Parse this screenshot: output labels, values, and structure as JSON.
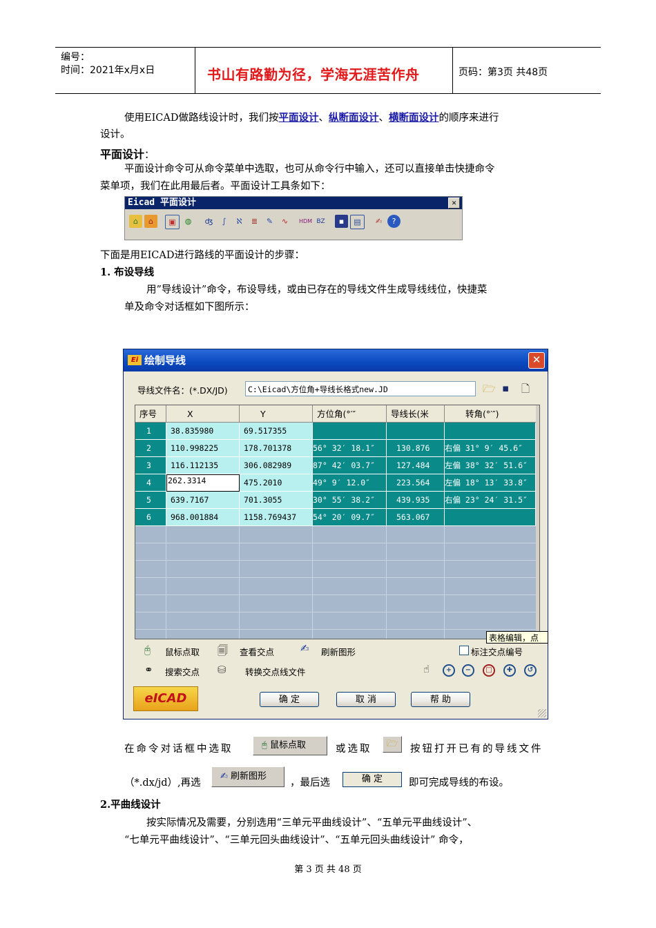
{
  "header": {
    "code_label": "编号：",
    "date_label": "时间：2021年x月x日",
    "motto": "书山有路勤为径，学海无涯苦作舟",
    "page_info": "页码：第3页  共48页"
  },
  "intro": {
    "p1_a": "使用EICAD做路线设计时，我们按",
    "link1": "平面设计",
    "sep1": "、",
    "link2": "纵断面设计",
    "sep2": "、",
    "link3": "横断面设计",
    "p1_b": "的顺序来进行",
    "p1_c": "设计。"
  },
  "section_plan": {
    "heading": "平面设计",
    "heading_colon": "：",
    "p_line1": "平面设计命令可从命令菜单中选取，也可从命令行中输入，还可以直接单击快捷命令",
    "p_line2": "菜单项，我们在此用最后者。平面设计工具条如下："
  },
  "toolbar": {
    "title": "Eicad 平面设计",
    "close": "✕"
  },
  "steps_intro": "下面是用EICAD进行路线的平面设计的步骤：",
  "step1": {
    "heading": "1. 布设导线",
    "p_line1": "用”导线设计”命令，布设导线，或由已存在的导线文件生成导线线位，快捷菜",
    "p_line2": "单及命令对话框如下图所示："
  },
  "dialog": {
    "title": "绘制导线",
    "close": "✕",
    "file_label": "导线文件名：(*.DX/JD)",
    "file_value": "C:\\Eicad\\方位角+导线长格式new.JD",
    "columns": [
      "序号",
      "X",
      "Y",
      "方位角(°′″",
      "导线长(米",
      "转角(°′″)"
    ],
    "rows": [
      [
        "1",
        "38.835980",
        "69.517355",
        "",
        "",
        ""
      ],
      [
        "2",
        "110.998225",
        "178.701378",
        "56° 32′ 18.1″",
        "130.876",
        "右偏 31° 9′ 45.6″"
      ],
      [
        "3",
        "116.112135",
        "306.082989",
        "87° 42′ 03.7″",
        "127.484",
        "左偏 38° 32′ 51.6″"
      ],
      [
        "4",
        "262.3314",
        "475.2010",
        "49° 9′ 12.0″",
        "223.564",
        "左偏 18° 13′ 33.8″"
      ],
      [
        "5",
        "639.7167",
        "701.3055",
        "30° 55′ 38.2″",
        "439.935",
        "右偏 23° 24′ 31.5″"
      ],
      [
        "6",
        "968.001884",
        "1158.769437",
        "54° 20′ 09.7″",
        "563.067",
        ""
      ]
    ],
    "tooltip": "表格编辑，点",
    "opt_pick": "鼠标点取",
    "opt_view": "查看交点",
    "opt_refresh": "刷新图形",
    "opt_mark": "标注交点编号",
    "opt_search": "搜索交点",
    "opt_convert": "转换交点线文件",
    "btn_ok": "确 定",
    "btn_cancel": "取 消",
    "btn_help": "帮 助",
    "logo": "eICAD"
  },
  "instruction": {
    "part1": "在命令对话框中选取",
    "btn_pick": "鼠标点取",
    "part2": "或选取",
    "part3": "按钮打开已有的导线文件",
    "part4": "（*.dx/jd）,再选",
    "btn_refresh": "刷新图形",
    "part5": "，最后选",
    "btn_ok": "确 定",
    "part6": "即可完成导线的布设。"
  },
  "step2": {
    "heading": "2.平曲线设计",
    "p_line1": "按实际情况及需要，分别选用“三单元平曲线设计”、“五单元平曲线设计”、",
    "p_line2": "“七单元平曲线设计”、“三单元回头曲线设计”、“五单元回头曲线设计”  命令，"
  },
  "footer": "第 3 页  共 48 页"
}
